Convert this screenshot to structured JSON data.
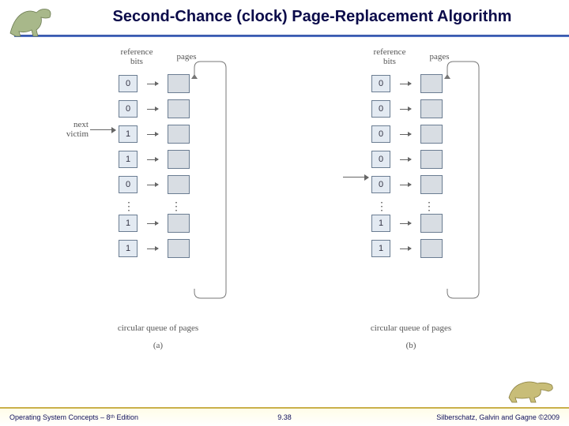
{
  "title": "Second-Chance (clock) Page-Replacement Algorithm",
  "labels": {
    "reference_bits": "reference\nbits",
    "pages": "pages",
    "next_victim": "next\nvictim",
    "circular": "circular queue of pages",
    "sub_a": "(a)",
    "sub_b": "(b)"
  },
  "panels": {
    "a": {
      "bits": [
        "0",
        "0",
        "1",
        "1",
        "0",
        "1",
        "1"
      ],
      "victim_row": 2
    },
    "b": {
      "bits": [
        "0",
        "0",
        "0",
        "0",
        "0",
        "1",
        "1"
      ],
      "victim_row": 4
    }
  },
  "footer": {
    "left": "Operating System Concepts – 8ᵗʰ Edition",
    "center": "9.38",
    "right": "Silberschatz, Galvin and Gagne ©2009"
  }
}
